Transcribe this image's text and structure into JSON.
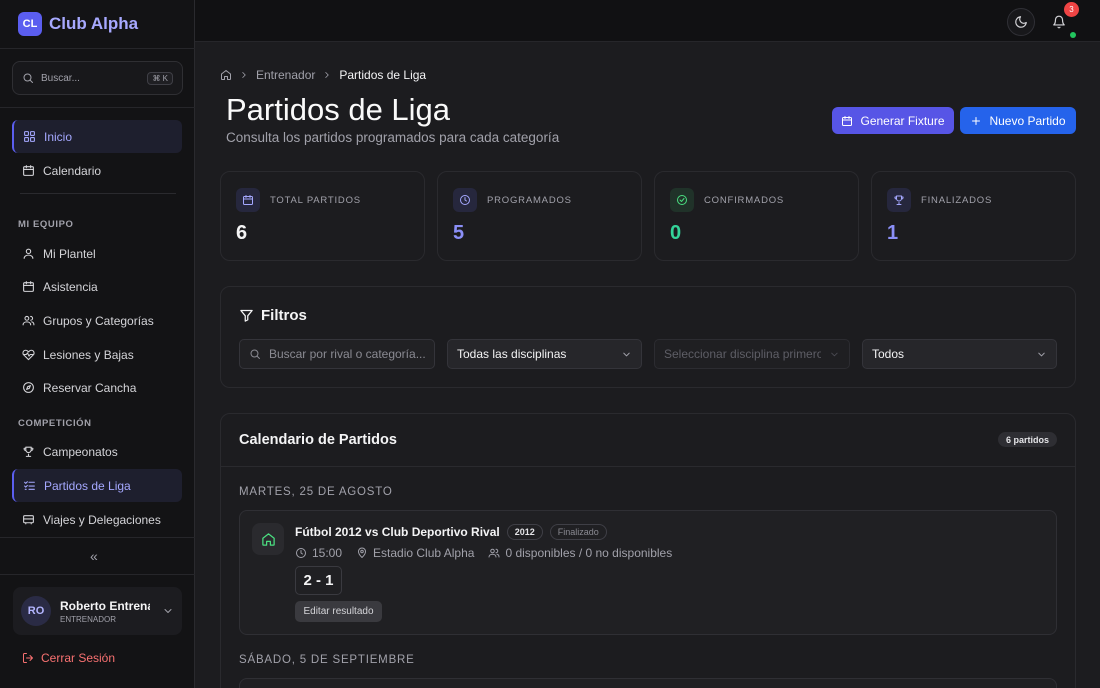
{
  "brand": {
    "logo": "CL",
    "name": "Club Alpha"
  },
  "search": {
    "placeholder": "Buscar...",
    "shortcut": "⌘ K"
  },
  "sidebar": {
    "main": [
      {
        "label": "Inicio",
        "icon": "grid-icon",
        "active": true
      },
      {
        "label": "Calendario",
        "icon": "calendar-icon"
      }
    ],
    "section_team": "MI EQUIPO",
    "team": [
      {
        "label": "Mi Plantel",
        "icon": "user-icon"
      },
      {
        "label": "Asistencia",
        "icon": "calendar-icon"
      },
      {
        "label": "Grupos y Categorías",
        "icon": "users-icon"
      },
      {
        "label": "Lesiones y Bajas",
        "icon": "heart-pulse-icon"
      },
      {
        "label": "Reservar Cancha",
        "icon": "compass-icon"
      }
    ],
    "section_comp": "COMPETICIÓN",
    "comp": [
      {
        "label": "Campeonatos",
        "icon": "trophy-icon"
      },
      {
        "label": "Partidos de Liga",
        "icon": "list-check-icon",
        "active": true
      },
      {
        "label": "Viajes y Delegaciones",
        "icon": "bus-icon"
      }
    ],
    "collapse": "«"
  },
  "user": {
    "initials": "RO",
    "name": "Roberto Entrenador",
    "role": "ENTRENADOR"
  },
  "logout": "Cerrar Sesión",
  "topbar": {
    "notifications": "3"
  },
  "breadcrumb": {
    "level1": "Entrenador",
    "current": "Partidos de Liga"
  },
  "page": {
    "title": "Partidos de Liga",
    "subtitle": "Consulta los partidos programados para cada categoría",
    "btn_fixture": "Generar Fixture",
    "btn_new": "Nuevo Partido"
  },
  "stats": [
    {
      "label": "TOTAL PARTIDOS",
      "value": "6",
      "color": "#f4f4f5",
      "icon": "calendar-icon",
      "bg": "#26273d",
      "fg": "#a5a8ff"
    },
    {
      "label": "PROGRAMADOS",
      "value": "5",
      "color": "#8b8ff7",
      "icon": "clock-icon",
      "bg": "#26273d",
      "fg": "#a5a8ff"
    },
    {
      "label": "CONFIRMADOS",
      "value": "0",
      "color": "#34d399",
      "icon": "check-circle-icon",
      "bg": "#203229",
      "fg": "#4ade80"
    },
    {
      "label": "FINALIZADOS",
      "value": "1",
      "color": "#8b8ff7",
      "icon": "trophy-icon",
      "bg": "#26273d",
      "fg": "#a5a8ff"
    }
  ],
  "filters": {
    "title": "Filtros",
    "search_placeholder": "Buscar por rival o categoría...",
    "discipline": "Todas las disciplinas",
    "discipline2": "Seleccionar disciplina primero",
    "state": "Todos"
  },
  "calendar": {
    "title": "Calendario de Partidos",
    "count": "6 partidos",
    "groups": [
      {
        "date": "MARTES, 25 DE AGOSTO",
        "match": {
          "title": "Fútbol 2012 vs Club Deportivo Rival",
          "category": "2012",
          "status": "Finalizado",
          "time": "15:00",
          "venue": "Estadio Club Alpha",
          "availability": "0 disponibles / 0 no disponibles",
          "score": "2 - 1",
          "edit": "Editar resultado"
        }
      },
      {
        "date": "SÁBADO, 5 DE SEPTIEMBRE"
      }
    ]
  }
}
